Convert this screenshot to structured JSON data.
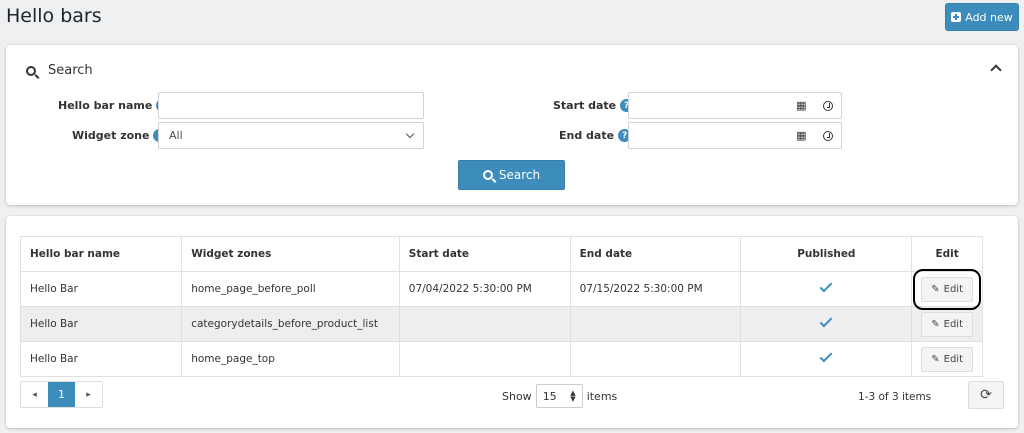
{
  "page": {
    "title": "Hello bars",
    "add_new_label": "Add new"
  },
  "search": {
    "heading": "Search",
    "button_label": "Search",
    "fields": {
      "name_label": "Hello bar name",
      "name_value": "",
      "zone_label": "Widget zone",
      "zone_value": "All",
      "start_label": "Start date",
      "start_value": "",
      "end_label": "End date",
      "end_value": ""
    }
  },
  "grid": {
    "columns": [
      "Hello bar name",
      "Widget zones",
      "Start date",
      "End date",
      "Published",
      "Edit"
    ],
    "rows": [
      {
        "name": "Hello Bar",
        "zone": "home_page_before_poll",
        "start": "07/04/2022 5:30:00 PM",
        "end": "07/15/2022 5:30:00 PM",
        "published": true,
        "edit": "Edit"
      },
      {
        "name": "Hello Bar",
        "zone": "categorydetails_before_product_list",
        "start": "",
        "end": "",
        "published": true,
        "edit": "Edit"
      },
      {
        "name": "Hello Bar",
        "zone": "home_page_top",
        "start": "",
        "end": "",
        "published": true,
        "edit": "Edit"
      }
    ]
  },
  "pager": {
    "prev": "◂",
    "current": "1",
    "next": "▸",
    "show_label": "Show",
    "page_size": "15",
    "items_label": "items",
    "summary": "1-3 of 3 items"
  },
  "colors": {
    "primary": "#3c8dbc",
    "background": "#eef0f2"
  },
  "icons": [
    "plus-square-icon",
    "search-icon",
    "chevron-up-icon",
    "help-icon",
    "calendar-icon",
    "clock-icon",
    "checkmark-icon",
    "pencil-icon",
    "refresh-icon"
  ]
}
